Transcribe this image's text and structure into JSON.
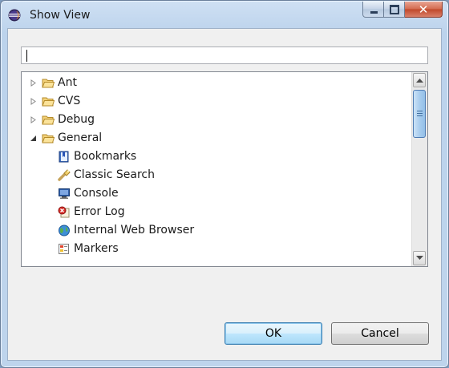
{
  "window": {
    "title": "Show View",
    "app_icon": "eclipse-icon",
    "controls": {
      "minimize": "minimize-icon",
      "maximize": "maximize-icon",
      "close_glyph": "✕"
    }
  },
  "search": {
    "value": "",
    "placeholder": ""
  },
  "tree": {
    "items": [
      {
        "label": "Ant",
        "icon": "folder-icon",
        "expanded": false,
        "level": 0
      },
      {
        "label": "CVS",
        "icon": "folder-icon",
        "expanded": false,
        "level": 0
      },
      {
        "label": "Debug",
        "icon": "folder-icon",
        "expanded": false,
        "level": 0
      },
      {
        "label": "General",
        "icon": "folder-icon",
        "expanded": true,
        "level": 0
      },
      {
        "label": "Bookmarks",
        "icon": "bookmarks-icon",
        "level": 1
      },
      {
        "label": "Classic Search",
        "icon": "search-flashlight-icon",
        "level": 1
      },
      {
        "label": "Console",
        "icon": "console-icon",
        "level": 1
      },
      {
        "label": "Error Log",
        "icon": "error-log-icon",
        "level": 1
      },
      {
        "label": "Internal Web Browser",
        "icon": "globe-icon",
        "level": 1
      },
      {
        "label": "Markers",
        "icon": "markers-icon",
        "level": 1
      }
    ]
  },
  "buttons": {
    "ok": "OK",
    "cancel": "Cancel"
  },
  "colors": {
    "accent": "#3c7fb1",
    "folder": "#e8b84a"
  }
}
